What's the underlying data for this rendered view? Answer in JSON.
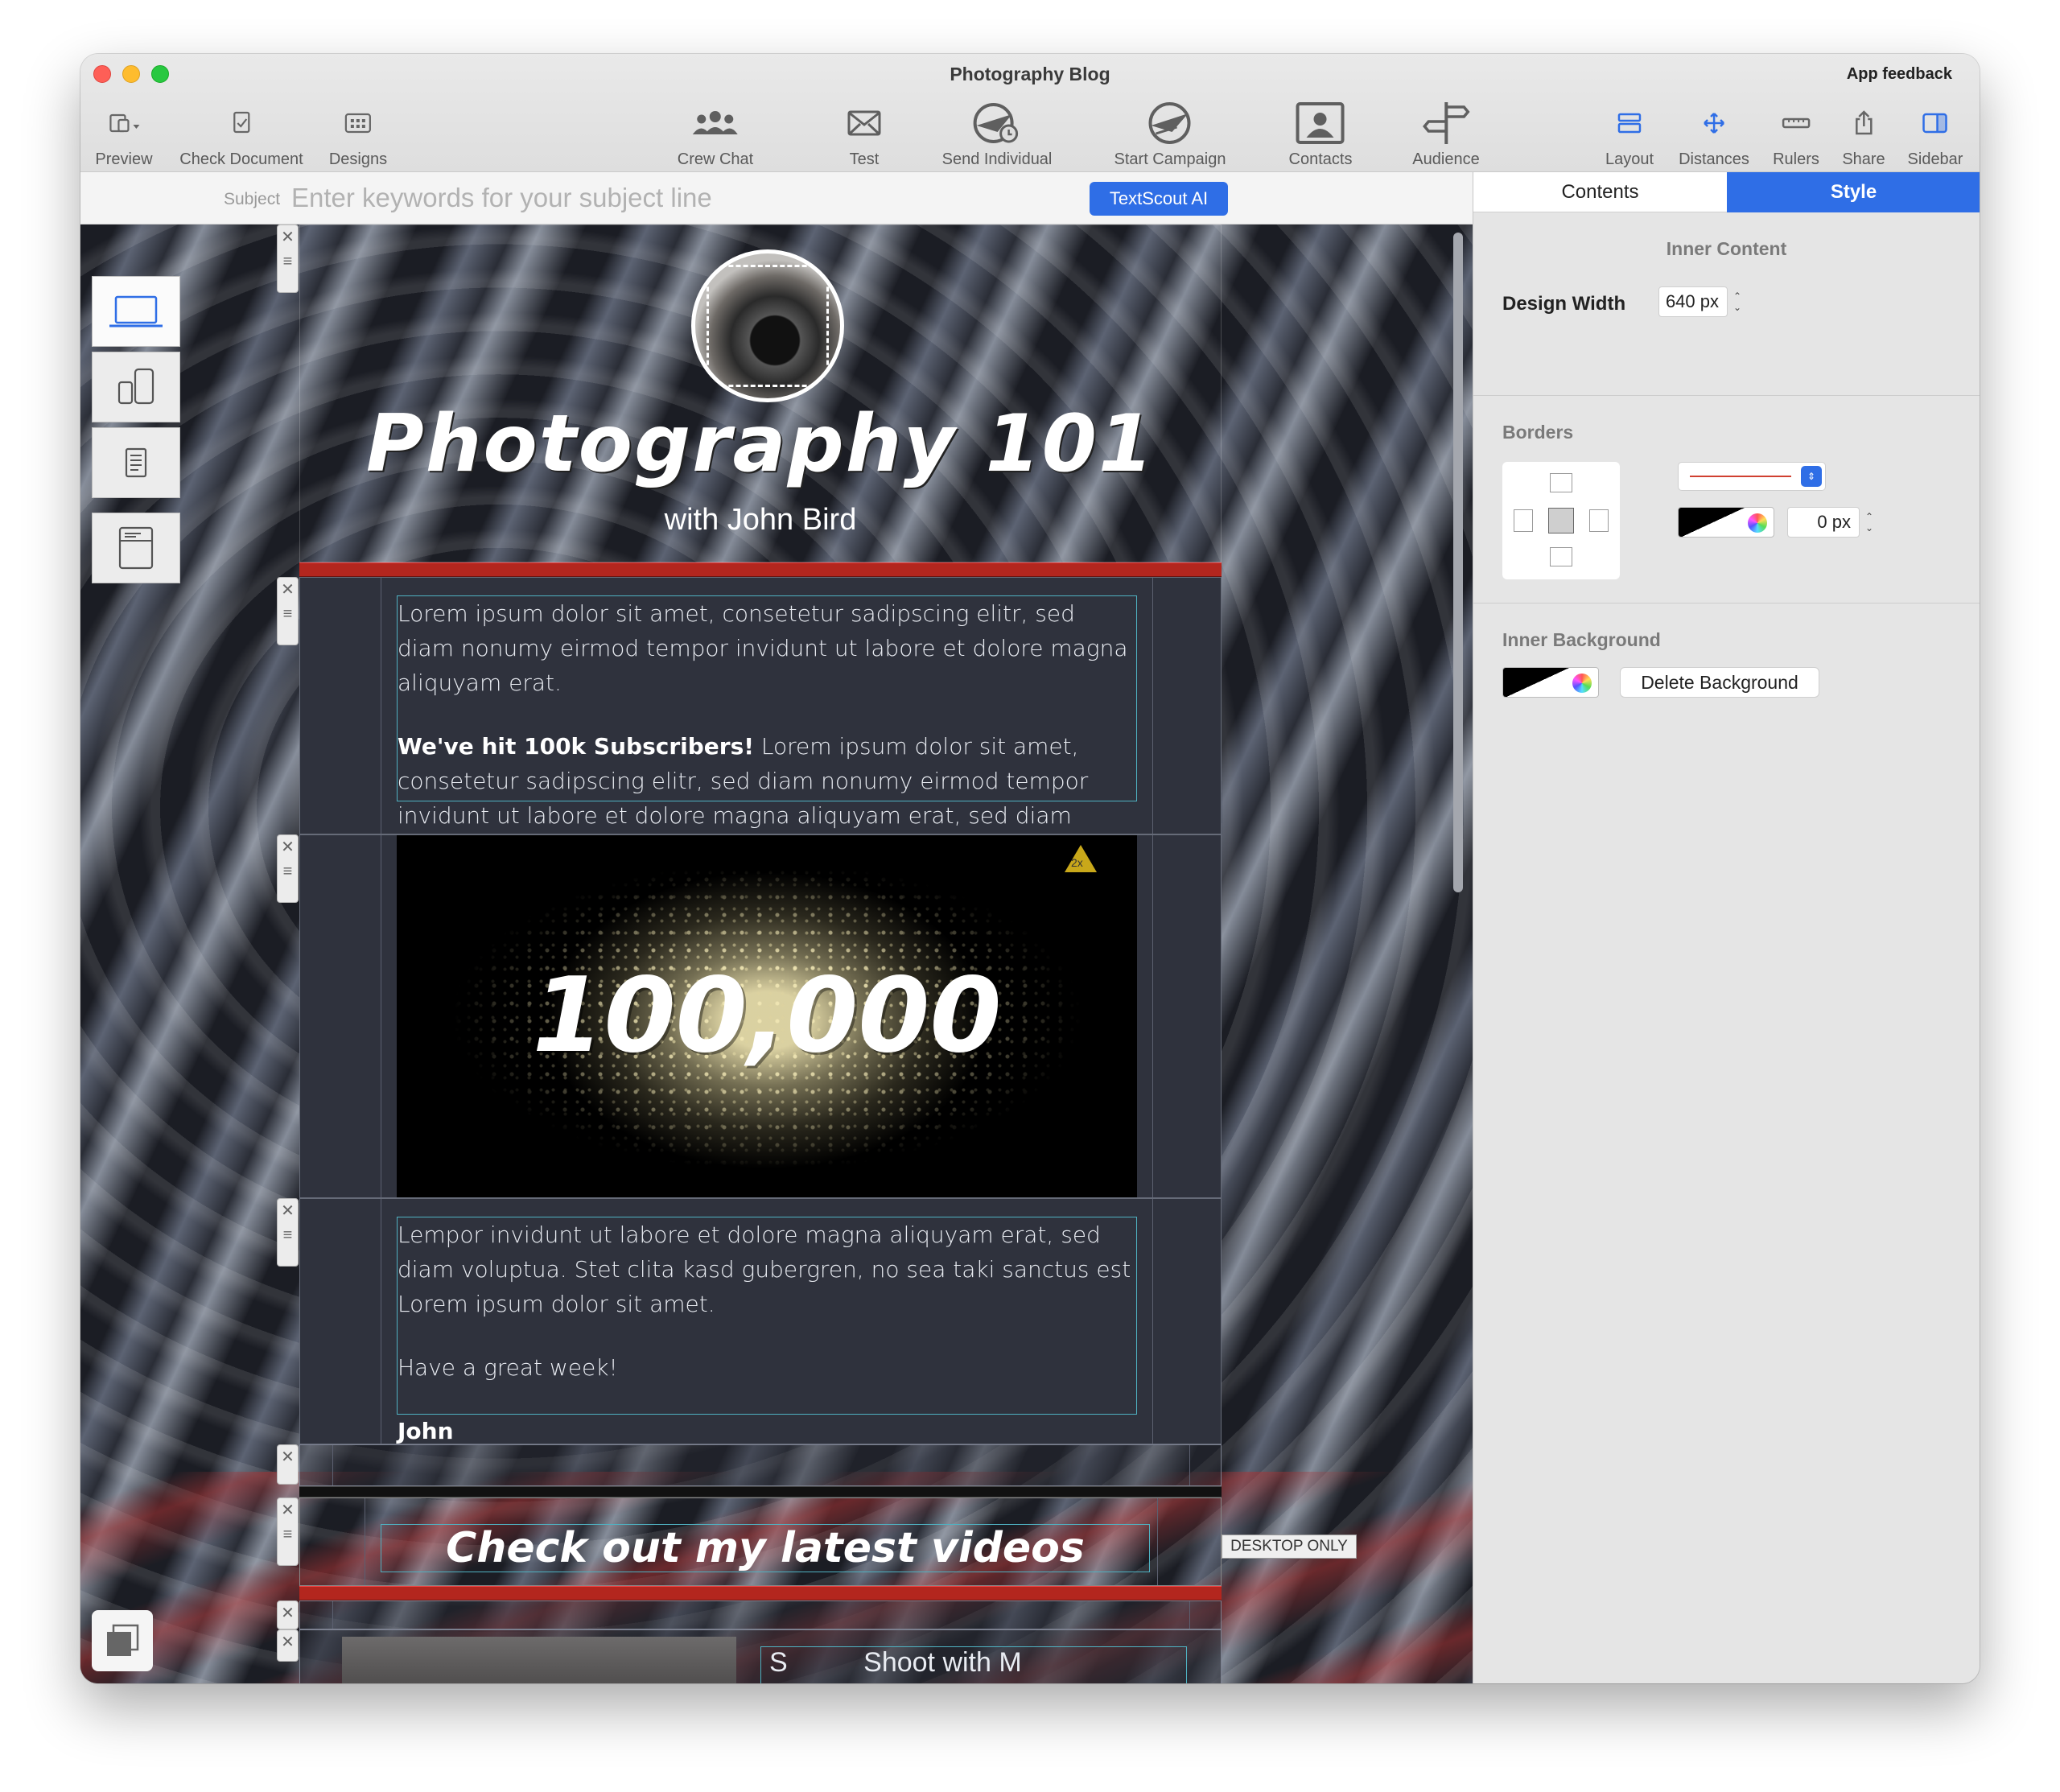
{
  "window": {
    "title": "Photography Blog",
    "feedback": "App feedback"
  },
  "toolbar": {
    "left": [
      {
        "label": "Preview",
        "icon": "preview-icon"
      },
      {
        "label": "Check Document",
        "icon": "check-document-icon"
      },
      {
        "label": "Designs",
        "icon": "designs-icon"
      }
    ],
    "center": [
      {
        "label": "Crew Chat",
        "icon": "crew-chat-icon"
      },
      {
        "label": "Test",
        "icon": "envelope-icon"
      },
      {
        "label": "Send Individual",
        "icon": "send-individual-icon"
      },
      {
        "label": "Start Campaign",
        "icon": "start-campaign-icon"
      },
      {
        "label": "Contacts",
        "icon": "contacts-icon"
      },
      {
        "label": "Audience",
        "icon": "audience-icon"
      }
    ],
    "right": [
      {
        "label": "Layout",
        "icon": "layout-icon"
      },
      {
        "label": "Distances",
        "icon": "distances-icon"
      },
      {
        "label": "Rulers",
        "icon": "rulers-icon"
      },
      {
        "label": "Share",
        "icon": "share-icon"
      },
      {
        "label": "Sidebar",
        "icon": "sidebar-icon"
      }
    ]
  },
  "subject": {
    "label": "Subject",
    "placeholder": "Enter keywords for your subject line",
    "value": "",
    "ai_button": "TextScout AI"
  },
  "email": {
    "header_title": "Photography 101",
    "header_subtitle": "with John Bird",
    "intro_paragraph": "Lorem ipsum dolor sit amet, consetetur sadipscing elitr, sed diam nonumy eirmod tempor invidunt ut labore et dolore magna aliquyam erat.",
    "milestone_bold": "We've hit 100k Subscribers!",
    "milestone_text": " Lorem ipsum dolor sit amet, consetetur sadipscing elitr, sed diam nonumy eirmod tempor invidunt ut labore et dolore magna aliquyam erat, sed diam voluptua.",
    "image_number": "100,000",
    "image_badge": "2x",
    "outro_paragraph": "Lempor invidunt ut labore et dolore magna aliquyam erat, sed diam voluptua. Stet clita kasd gubergren, no sea taki sanctus est Lorem ipsum dolor sit amet.",
    "closing": "Have a great week!",
    "signature": "John",
    "desktop_badge": "DESKTOP ONLY",
    "videos_heading": "Check out my latest videos",
    "cut_text": "S          Shoot with M"
  },
  "sidebar": {
    "tabs": [
      "Contents",
      "Style"
    ],
    "active_tab": "Style",
    "inner_content_heading": "Inner Content",
    "design_width_label": "Design Width",
    "design_width_value": "640 px",
    "borders_heading": "Borders",
    "border_width_value": "0 px",
    "inner_background_heading": "Inner Background",
    "delete_background_label": "Delete Background",
    "colors": {
      "accent": "#2f6ee6",
      "border_line": "#d04030"
    }
  }
}
